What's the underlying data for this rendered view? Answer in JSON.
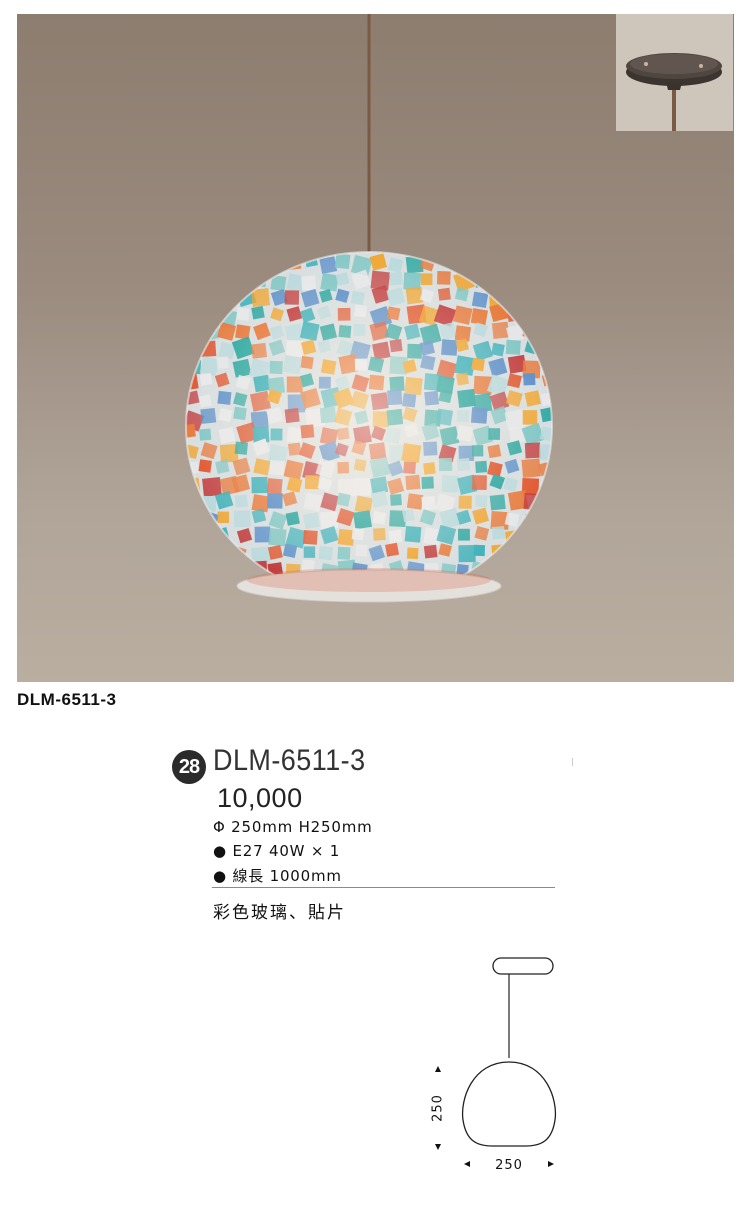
{
  "product": {
    "code": "DLM-6511-3",
    "badge_number": "28",
    "price": "10,000",
    "size": "Φ 250mm H250mm",
    "bulb": "● E27 40W × 1",
    "cord": "● 線長 1000mm",
    "material": "彩色玻璃、貼片"
  },
  "drawing": {
    "height_label": "250",
    "width_label": "250"
  },
  "colors": {
    "background": "#ffffff",
    "wall": "#9a8b7e",
    "badge": "#2b2b2b"
  }
}
